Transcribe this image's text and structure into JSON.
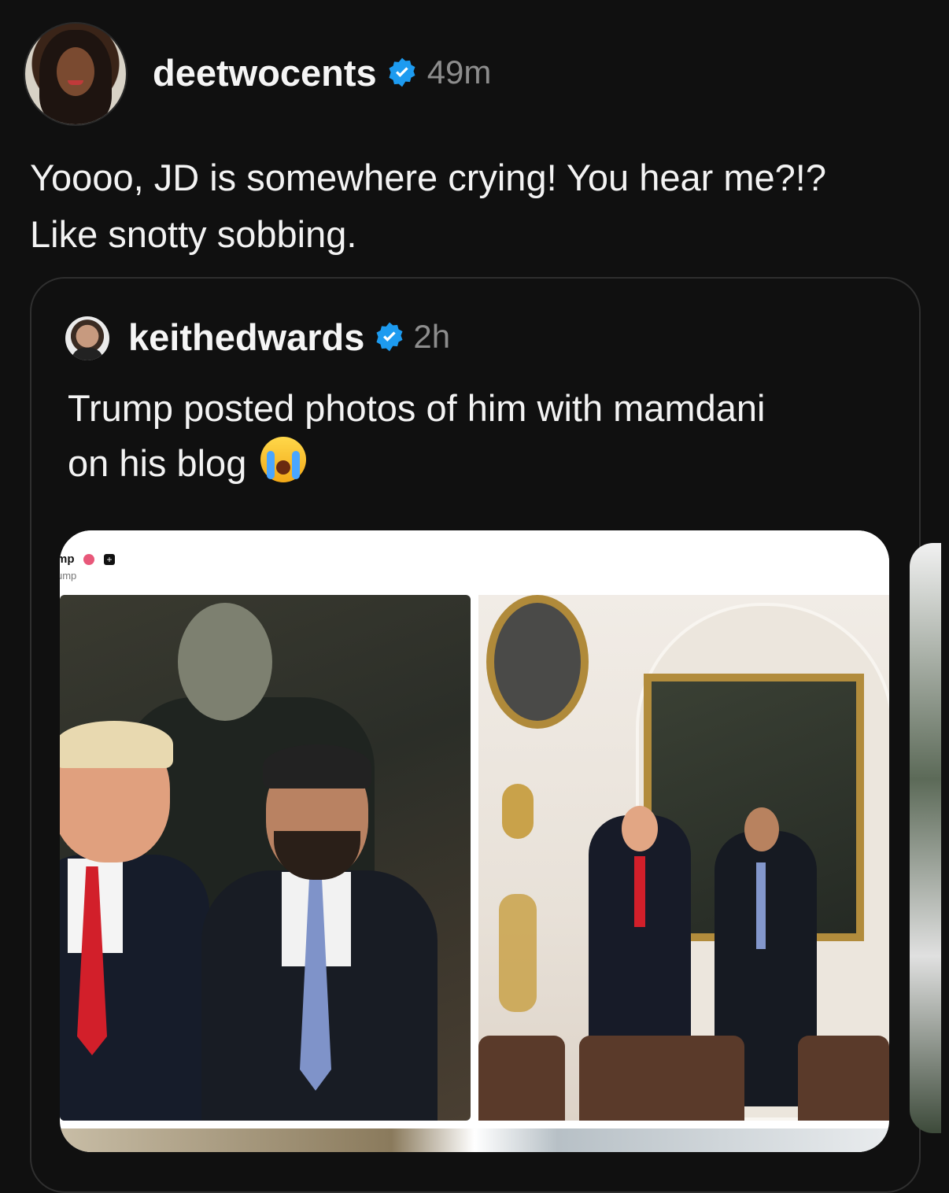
{
  "post": {
    "username": "deetwocents",
    "time": "49m",
    "text_line1": "Yoooo, JD is somewhere crying! You hear me?!?",
    "text_line2": "Like snotty sobbing."
  },
  "quote": {
    "username": "keithedwards",
    "time": "2h",
    "text_line1": "Trump posted photos of him with mamdani",
    "text_line2": "on his blog",
    "emoji": "loudly-crying-face"
  },
  "embedded_image": {
    "header_name": "mp",
    "header_handle": "ump"
  },
  "colors": {
    "background": "#101010",
    "verified": "#1d9bf0",
    "muted_text": "#8d8d8d"
  }
}
